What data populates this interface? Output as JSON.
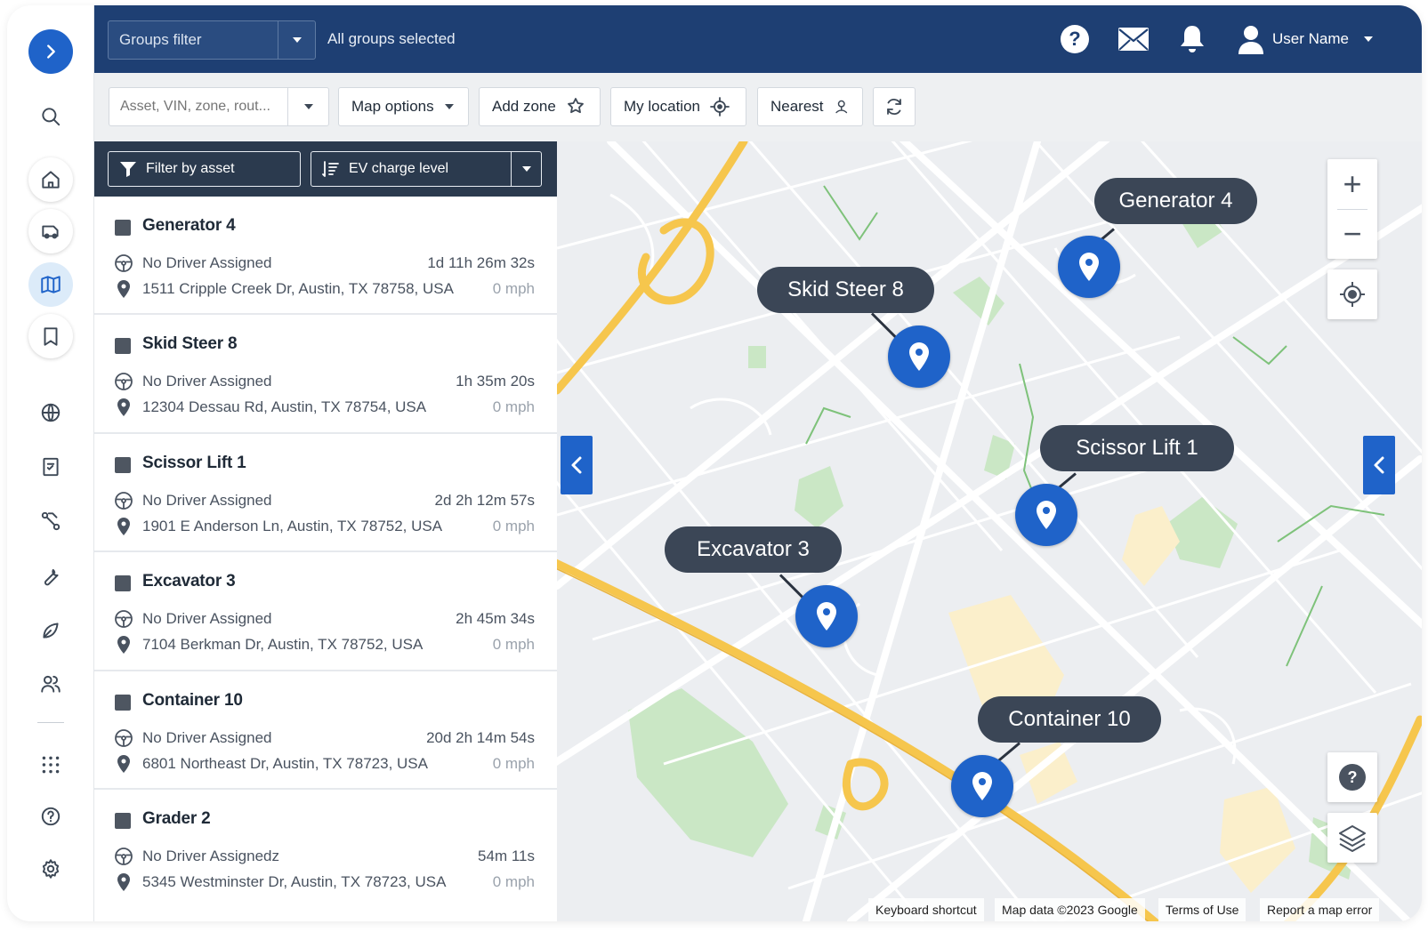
{
  "header": {
    "groups_filter_label": "Groups filter",
    "groups_selected": "All groups selected",
    "user_name": "User Name"
  },
  "toolbar": {
    "search_placeholder": "Asset, VIN, zone, rout...",
    "map_options": "Map options",
    "add_zone": "Add zone",
    "my_location": "My location",
    "nearest": "Nearest"
  },
  "panel": {
    "filter_by_asset": "Filter by asset",
    "sort_label": "EV charge level"
  },
  "assets": [
    {
      "name": "Generator 4",
      "driver": "No Driver Assigned",
      "duration": "1d 11h 26m 32s",
      "address": "1511 Cripple Creek Dr, Austin, TX 78758, USA",
      "speed": "0 mph"
    },
    {
      "name": "Skid Steer 8",
      "driver": "No Driver Assigned",
      "duration": "1h 35m 20s",
      "address": "12304 Dessau Rd, Austin, TX 78754, USA",
      "speed": "0 mph"
    },
    {
      "name": "Scissor Lift 1",
      "driver": "No Driver Assigned",
      "duration": "2d 2h 12m 57s",
      "address": "1901 E Anderson Ln, Austin, TX 78752, USA",
      "speed": "0 mph"
    },
    {
      "name": "Excavator 3",
      "driver": "No Driver Assigned",
      "duration": "2h 45m 34s",
      "address": "7104 Berkman Dr, Austin, TX 78752, USA",
      "speed": "0 mph"
    },
    {
      "name": "Container 10",
      "driver": "No Driver Assigned",
      "duration": "20d 2h 14m 54s",
      "address": "6801 Northeast Dr, Austin, TX 78723, USA",
      "speed": "0 mph"
    },
    {
      "name": "Grader 2",
      "driver": "No Driver Assignedz",
      "duration": "54m 11s",
      "address": "5345 Westminster Dr, Austin, TX 78723, USA",
      "speed": "0 mph"
    }
  ],
  "map": {
    "labels": [
      "Generator 4",
      "Skid Steer 8",
      "Scissor Lift 1",
      "Excavator 3",
      "Container 10"
    ],
    "attribution": {
      "keyboard": "Keyboard shortcut",
      "map_data": "Map data ©2023 Google",
      "terms": "Terms of Use",
      "report": "Report a map error"
    }
  },
  "colors": {
    "header": "#1e3f73",
    "accent": "#1f63c9",
    "panel_head": "#2b3a4e",
    "tag": "#3b4656",
    "highway": "#f6c64d"
  },
  "icons": {
    "rail": [
      "chevron-right-icon",
      "search-icon",
      "home-icon",
      "truck-icon",
      "map-icon",
      "bookmark-icon",
      "globe-icon",
      "checklist-icon",
      "route-icon",
      "wrench-icon",
      "leaf-icon",
      "people-icon",
      "apps-grid-icon",
      "help-icon",
      "gear-icon"
    ]
  }
}
